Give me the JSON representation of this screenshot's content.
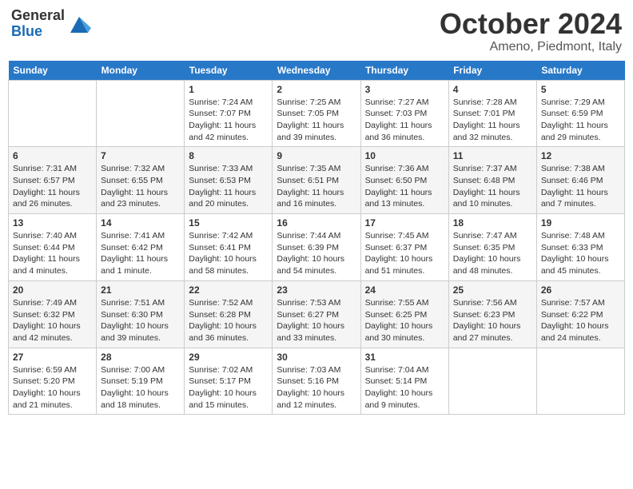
{
  "header": {
    "logo_general": "General",
    "logo_blue": "Blue",
    "month_title": "October 2024",
    "subtitle": "Ameno, Piedmont, Italy"
  },
  "weekdays": [
    "Sunday",
    "Monday",
    "Tuesday",
    "Wednesday",
    "Thursday",
    "Friday",
    "Saturday"
  ],
  "weeks": [
    [
      {
        "day": "",
        "sunrise": "",
        "sunset": "",
        "daylight": ""
      },
      {
        "day": "",
        "sunrise": "",
        "sunset": "",
        "daylight": ""
      },
      {
        "day": "1",
        "sunrise": "Sunrise: 7:24 AM",
        "sunset": "Sunset: 7:07 PM",
        "daylight": "Daylight: 11 hours and 42 minutes."
      },
      {
        "day": "2",
        "sunrise": "Sunrise: 7:25 AM",
        "sunset": "Sunset: 7:05 PM",
        "daylight": "Daylight: 11 hours and 39 minutes."
      },
      {
        "day": "3",
        "sunrise": "Sunrise: 7:27 AM",
        "sunset": "Sunset: 7:03 PM",
        "daylight": "Daylight: 11 hours and 36 minutes."
      },
      {
        "day": "4",
        "sunrise": "Sunrise: 7:28 AM",
        "sunset": "Sunset: 7:01 PM",
        "daylight": "Daylight: 11 hours and 32 minutes."
      },
      {
        "day": "5",
        "sunrise": "Sunrise: 7:29 AM",
        "sunset": "Sunset: 6:59 PM",
        "daylight": "Daylight: 11 hours and 29 minutes."
      }
    ],
    [
      {
        "day": "6",
        "sunrise": "Sunrise: 7:31 AM",
        "sunset": "Sunset: 6:57 PM",
        "daylight": "Daylight: 11 hours and 26 minutes."
      },
      {
        "day": "7",
        "sunrise": "Sunrise: 7:32 AM",
        "sunset": "Sunset: 6:55 PM",
        "daylight": "Daylight: 11 hours and 23 minutes."
      },
      {
        "day": "8",
        "sunrise": "Sunrise: 7:33 AM",
        "sunset": "Sunset: 6:53 PM",
        "daylight": "Daylight: 11 hours and 20 minutes."
      },
      {
        "day": "9",
        "sunrise": "Sunrise: 7:35 AM",
        "sunset": "Sunset: 6:51 PM",
        "daylight": "Daylight: 11 hours and 16 minutes."
      },
      {
        "day": "10",
        "sunrise": "Sunrise: 7:36 AM",
        "sunset": "Sunset: 6:50 PM",
        "daylight": "Daylight: 11 hours and 13 minutes."
      },
      {
        "day": "11",
        "sunrise": "Sunrise: 7:37 AM",
        "sunset": "Sunset: 6:48 PM",
        "daylight": "Daylight: 11 hours and 10 minutes."
      },
      {
        "day": "12",
        "sunrise": "Sunrise: 7:38 AM",
        "sunset": "Sunset: 6:46 PM",
        "daylight": "Daylight: 11 hours and 7 minutes."
      }
    ],
    [
      {
        "day": "13",
        "sunrise": "Sunrise: 7:40 AM",
        "sunset": "Sunset: 6:44 PM",
        "daylight": "Daylight: 11 hours and 4 minutes."
      },
      {
        "day": "14",
        "sunrise": "Sunrise: 7:41 AM",
        "sunset": "Sunset: 6:42 PM",
        "daylight": "Daylight: 11 hours and 1 minute."
      },
      {
        "day": "15",
        "sunrise": "Sunrise: 7:42 AM",
        "sunset": "Sunset: 6:41 PM",
        "daylight": "Daylight: 10 hours and 58 minutes."
      },
      {
        "day": "16",
        "sunrise": "Sunrise: 7:44 AM",
        "sunset": "Sunset: 6:39 PM",
        "daylight": "Daylight: 10 hours and 54 minutes."
      },
      {
        "day": "17",
        "sunrise": "Sunrise: 7:45 AM",
        "sunset": "Sunset: 6:37 PM",
        "daylight": "Daylight: 10 hours and 51 minutes."
      },
      {
        "day": "18",
        "sunrise": "Sunrise: 7:47 AM",
        "sunset": "Sunset: 6:35 PM",
        "daylight": "Daylight: 10 hours and 48 minutes."
      },
      {
        "day": "19",
        "sunrise": "Sunrise: 7:48 AM",
        "sunset": "Sunset: 6:33 PM",
        "daylight": "Daylight: 10 hours and 45 minutes."
      }
    ],
    [
      {
        "day": "20",
        "sunrise": "Sunrise: 7:49 AM",
        "sunset": "Sunset: 6:32 PM",
        "daylight": "Daylight: 10 hours and 42 minutes."
      },
      {
        "day": "21",
        "sunrise": "Sunrise: 7:51 AM",
        "sunset": "Sunset: 6:30 PM",
        "daylight": "Daylight: 10 hours and 39 minutes."
      },
      {
        "day": "22",
        "sunrise": "Sunrise: 7:52 AM",
        "sunset": "Sunset: 6:28 PM",
        "daylight": "Daylight: 10 hours and 36 minutes."
      },
      {
        "day": "23",
        "sunrise": "Sunrise: 7:53 AM",
        "sunset": "Sunset: 6:27 PM",
        "daylight": "Daylight: 10 hours and 33 minutes."
      },
      {
        "day": "24",
        "sunrise": "Sunrise: 7:55 AM",
        "sunset": "Sunset: 6:25 PM",
        "daylight": "Daylight: 10 hours and 30 minutes."
      },
      {
        "day": "25",
        "sunrise": "Sunrise: 7:56 AM",
        "sunset": "Sunset: 6:23 PM",
        "daylight": "Daylight: 10 hours and 27 minutes."
      },
      {
        "day": "26",
        "sunrise": "Sunrise: 7:57 AM",
        "sunset": "Sunset: 6:22 PM",
        "daylight": "Daylight: 10 hours and 24 minutes."
      }
    ],
    [
      {
        "day": "27",
        "sunrise": "Sunrise: 6:59 AM",
        "sunset": "Sunset: 5:20 PM",
        "daylight": "Daylight: 10 hours and 21 minutes."
      },
      {
        "day": "28",
        "sunrise": "Sunrise: 7:00 AM",
        "sunset": "Sunset: 5:19 PM",
        "daylight": "Daylight: 10 hours and 18 minutes."
      },
      {
        "day": "29",
        "sunrise": "Sunrise: 7:02 AM",
        "sunset": "Sunset: 5:17 PM",
        "daylight": "Daylight: 10 hours and 15 minutes."
      },
      {
        "day": "30",
        "sunrise": "Sunrise: 7:03 AM",
        "sunset": "Sunset: 5:16 PM",
        "daylight": "Daylight: 10 hours and 12 minutes."
      },
      {
        "day": "31",
        "sunrise": "Sunrise: 7:04 AM",
        "sunset": "Sunset: 5:14 PM",
        "daylight": "Daylight: 10 hours and 9 minutes."
      },
      {
        "day": "",
        "sunrise": "",
        "sunset": "",
        "daylight": ""
      },
      {
        "day": "",
        "sunrise": "",
        "sunset": "",
        "daylight": ""
      }
    ]
  ]
}
